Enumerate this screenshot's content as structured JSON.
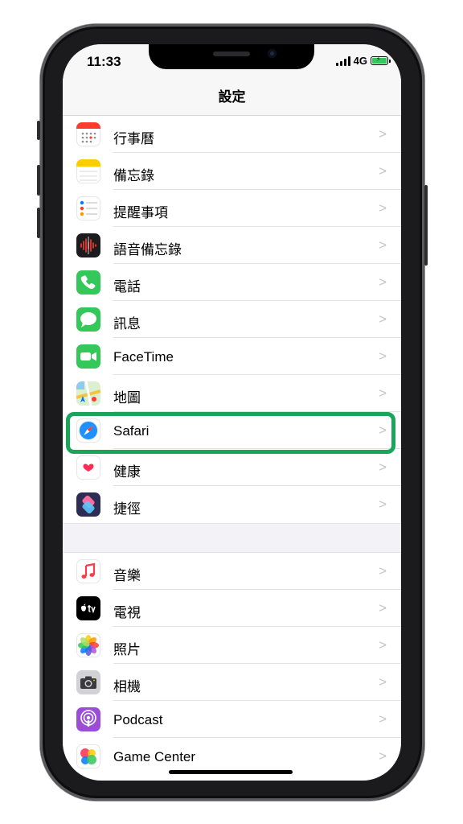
{
  "status_bar": {
    "time": "11:33",
    "network": "4G"
  },
  "nav": {
    "title": "設定"
  },
  "groups": [
    {
      "items": [
        {
          "label": "行事曆",
          "icon": "calendar-icon"
        },
        {
          "label": "備忘錄",
          "icon": "notes-icon"
        },
        {
          "label": "提醒事項",
          "icon": "reminders-icon"
        },
        {
          "label": "語音備忘錄",
          "icon": "voice-memos-icon"
        },
        {
          "label": "電話",
          "icon": "phone-icon"
        },
        {
          "label": "訊息",
          "icon": "messages-icon"
        },
        {
          "label": "FaceTime",
          "icon": "facetime-icon"
        },
        {
          "label": "地圖",
          "icon": "maps-icon"
        },
        {
          "label": "Safari",
          "icon": "safari-icon"
        },
        {
          "label": "健康",
          "icon": "health-icon"
        },
        {
          "label": "捷徑",
          "icon": "shortcuts-icon"
        }
      ]
    },
    {
      "items": [
        {
          "label": "音樂",
          "icon": "music-icon"
        },
        {
          "label": "電視",
          "icon": "tv-icon"
        },
        {
          "label": "照片",
          "icon": "photos-icon"
        },
        {
          "label": "相機",
          "icon": "camera-icon"
        },
        {
          "label": "Podcast",
          "icon": "podcast-icon"
        },
        {
          "label": "Game Center",
          "icon": "game-center-icon"
        }
      ]
    }
  ],
  "highlighted_item": "Safari",
  "colors": {
    "highlight": "#1aa55a",
    "battery": "#34c759",
    "chevron": "#c4c4c7",
    "separator": "#e3e3e6"
  }
}
